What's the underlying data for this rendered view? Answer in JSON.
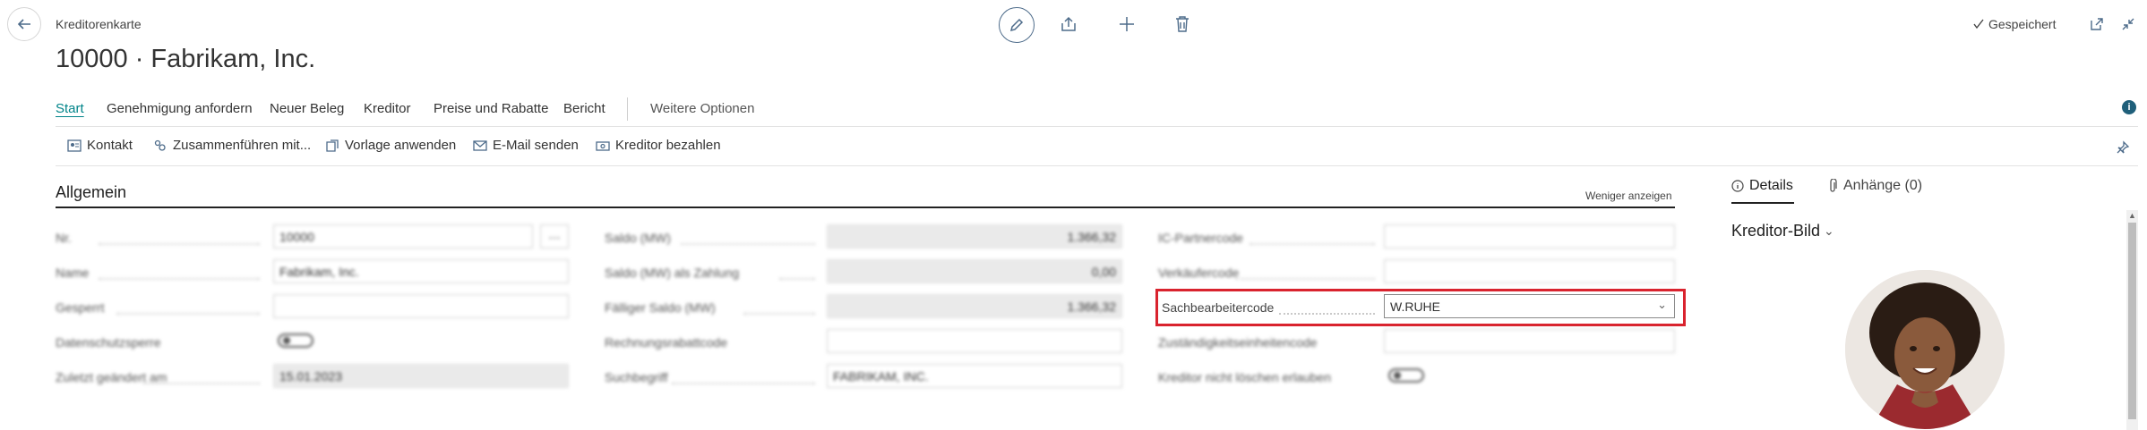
{
  "header": {
    "breadcrumb": "Kreditorenkarte",
    "title": "10000 · Fabrikam, Inc.",
    "saved_status": "Gespeichert"
  },
  "tabs": [
    "Start",
    "Genehmigung anfordern",
    "Neuer Beleg",
    "Kreditor",
    "Preise und Rabatte",
    "Bericht",
    "Weitere Optionen"
  ],
  "actions": [
    "Kontakt",
    "Zusammenführen mit...",
    "Vorlage anwenden",
    "E-Mail senden",
    "Kreditor bezahlen"
  ],
  "general": {
    "title": "Allgemein",
    "show_less": "Weniger anzeigen",
    "col1": {
      "labels": [
        "Nr.",
        "Name",
        "Gesperrt",
        "Datenschutzsperre",
        "Zuletzt geändert am"
      ],
      "no": "10000",
      "name": "Fabrikam, Inc.",
      "blocked": "",
      "last_modified": "15.01.2023"
    },
    "col2": {
      "labels": [
        "Saldo (MW)",
        "Saldo (MW) als Zahlung",
        "Fälliger Saldo (MW)",
        "Rechnungsrabattcode",
        "Suchbegriff"
      ],
      "balance": "1.366,32",
      "balance_payments": "0,00",
      "balance_due": "1.366,32",
      "invoice_discount": "",
      "search_name": "FABRIKAM, INC."
    },
    "col3": {
      "labels": [
        "IC-Partnercode",
        "Verkäufercode",
        "Sachbearbeitercode",
        "Zuständigkeitseinheitencode",
        "Kreditor nicht löschen erlauben"
      ],
      "ic_partner": "",
      "purchaser": "",
      "responsibility_center": "",
      "agent_value": "W.RUHE"
    }
  },
  "factbox": {
    "tab_details": "Details",
    "tab_attachments": "Anhänge (0)",
    "picture_title": "Kreditor-Bild"
  },
  "colors": {
    "accent": "#008489",
    "highlight": "#d9232e",
    "icon": "#4d6b8a"
  }
}
